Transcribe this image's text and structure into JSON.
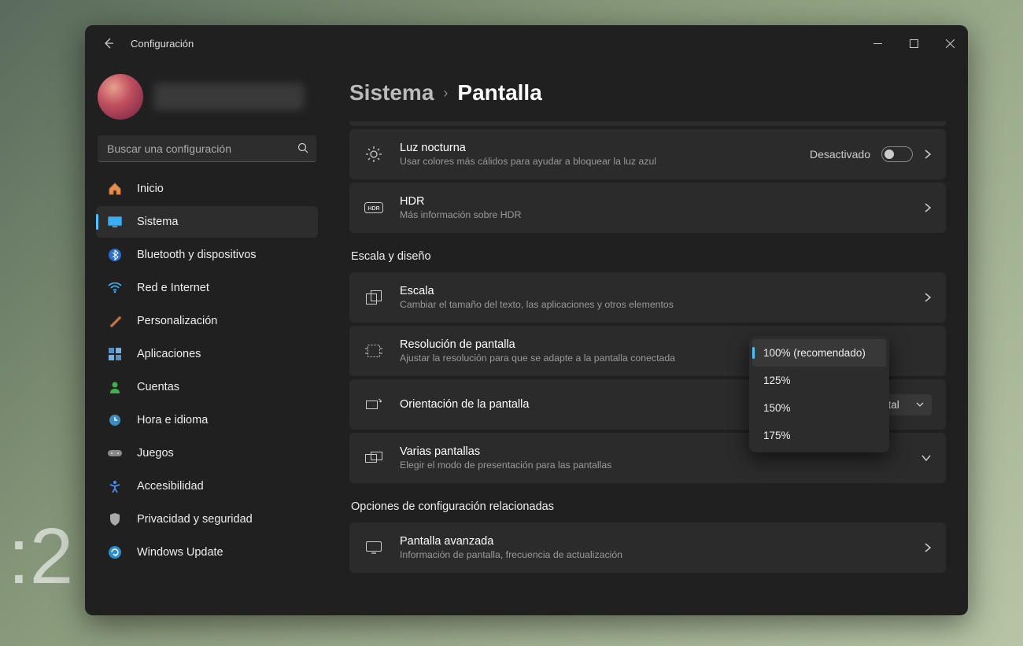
{
  "titlebar": {
    "app_title": "Configuración"
  },
  "search": {
    "placeholder": "Buscar una configuración"
  },
  "sidebar": {
    "items": [
      {
        "label": "Inicio"
      },
      {
        "label": "Sistema"
      },
      {
        "label": "Bluetooth y dispositivos"
      },
      {
        "label": "Red e Internet"
      },
      {
        "label": "Personalización"
      },
      {
        "label": "Aplicaciones"
      },
      {
        "label": "Cuentas"
      },
      {
        "label": "Hora e idioma"
      },
      {
        "label": "Juegos"
      },
      {
        "label": "Accesibilidad"
      },
      {
        "label": "Privacidad y seguridad"
      },
      {
        "label": "Windows Update"
      }
    ]
  },
  "breadcrumb": {
    "parent": "Sistema",
    "current": "Pantalla"
  },
  "cards": {
    "night_light": {
      "title": "Luz nocturna",
      "sub": "Usar colores más cálidos para ayudar a bloquear la luz azul",
      "state_label": "Desactivado"
    },
    "hdr": {
      "title": "HDR",
      "sub": "Más información sobre HDR"
    },
    "scale": {
      "title": "Escala",
      "sub": "Cambiar el tamaño del texto, las aplicaciones y otros elementos",
      "options": [
        "100% (recomendado)",
        "125%",
        "150%",
        "175%"
      ],
      "selected_index": 0
    },
    "resolution": {
      "title": "Resolución de pantalla",
      "sub": "Ajustar la resolución para que se adapte a la pantalla conectada"
    },
    "orientation": {
      "title": "Orientación de la pantalla",
      "value": "Horizontal"
    },
    "multi": {
      "title": "Varias pantallas",
      "sub": "Elegir el modo de presentación para las pantallas"
    },
    "advanced": {
      "title": "Pantalla avanzada",
      "sub": "Información de pantalla, frecuencia de actualización"
    }
  },
  "sections": {
    "scale_design": "Escala y diseño",
    "related": "Opciones de configuración relacionadas"
  }
}
